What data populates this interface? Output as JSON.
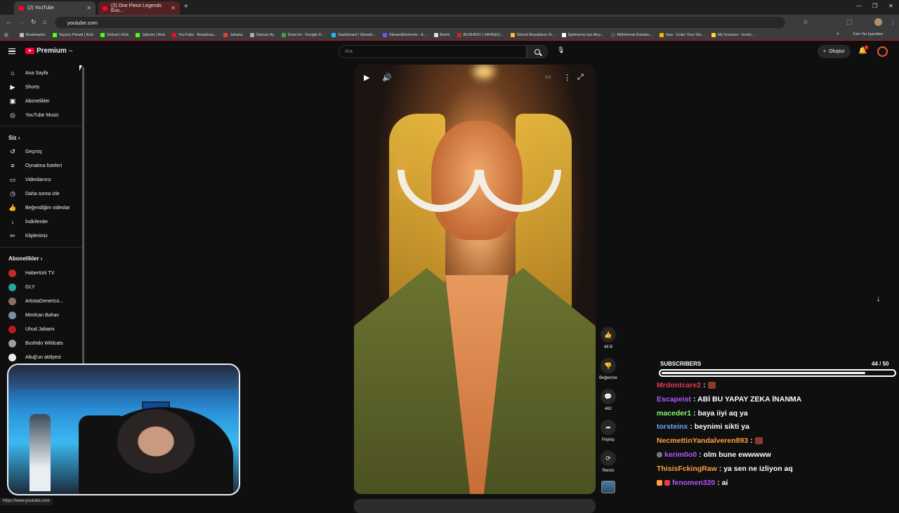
{
  "browser": {
    "tabs": [
      {
        "label": "(2) YouTube"
      },
      {
        "label": "(2) One Piece Legends Evo..."
      }
    ],
    "url": "youtube.com",
    "all_bookmarks_label": "Tüm Yer İşaretleri",
    "status_url": "https://www.youtube.com",
    "bookmarks": [
      {
        "label": "Bookmarks",
        "color": "#bbbbbb"
      },
      {
        "label": "Yayıncı Paneli | Kick",
        "color": "#53fc18"
      },
      {
        "label": "Götzat | Kick",
        "color": "#53fc18"
      },
      {
        "label": "Jahrein | Kick",
        "color": "#53fc18"
      },
      {
        "label": "YouTube - Broadcas...",
        "color": "#ff0033"
      },
      {
        "label": "Jaharia",
        "color": "#e04040"
      },
      {
        "label": "Oturum Aç",
        "color": "#aaaaaa"
      },
      {
        "label": "Drive'ım - Google D...",
        "color": "#34a853"
      },
      {
        "label": "Dashboard / Stream...",
        "color": "#29b6f6"
      },
      {
        "label": "StreamElements - A...",
        "color": "#7c4dff"
      },
      {
        "label": "Botrix",
        "color": "#dddddd"
      },
      {
        "label": "BUSHIDO | SAVAŞÇI...",
        "color": "#c62828"
      },
      {
        "label": "Görsel Boyutlarını N...",
        "color": "#fbc02d"
      },
      {
        "label": "İşletmeniz için Akıy...",
        "color": "#ffffff"
      },
      {
        "label": "Mühimmat Kutuları...",
        "color": "#555555"
      },
      {
        "label": "ikas - Enter Your Sto...",
        "color": "#ffb300"
      },
      {
        "label": "My Invoices - Invoic...",
        "color": "#fdd835"
      }
    ]
  },
  "header": {
    "logo_text": "Premium",
    "logo_badge": "TR",
    "search_placeholder": "Ara",
    "create_label": "Oluştur",
    "notifications_count": "2"
  },
  "sidebar": {
    "main": [
      {
        "label": "Ana Sayfa",
        "icon": "home-icon",
        "glyph": "⌂"
      },
      {
        "label": "Shorts",
        "icon": "shorts-icon",
        "glyph": "▶"
      },
      {
        "label": "Abonelikler",
        "icon": "subscriptions-icon",
        "glyph": "▣"
      },
      {
        "label": "YouTube Music",
        "icon": "music-icon",
        "glyph": "◎"
      }
    ],
    "you_heading": "Siz",
    "you_items": [
      {
        "label": "Geçmiş",
        "icon": "history-icon",
        "glyph": "↺"
      },
      {
        "label": "Oynatma listeleri",
        "icon": "playlist-icon",
        "glyph": "≡"
      },
      {
        "label": "Videolarınız",
        "icon": "your-videos-icon",
        "glyph": "▭"
      },
      {
        "label": "Daha sonra izle",
        "icon": "watch-later-icon",
        "glyph": "◷"
      },
      {
        "label": "Beğendiğim videolar",
        "icon": "liked-icon",
        "glyph": "👍"
      },
      {
        "label": "İndirilenler",
        "icon": "download-icon",
        "glyph": "↓"
      },
      {
        "label": "Kliplerimiz",
        "icon": "clips-icon",
        "glyph": "✂"
      }
    ],
    "subs_heading": "Abonelikler",
    "channels": [
      {
        "label": "Habertürk TV",
        "color": "#c62828"
      },
      {
        "label": "GLY",
        "color": "#26a69a"
      },
      {
        "label": "ArtistaGenerico...",
        "color": "#8d6e63"
      },
      {
        "label": "Mevlcan Bahav",
        "color": "#78909c"
      },
      {
        "label": "Uhud Jabami",
        "color": "#b71c1c"
      },
      {
        "label": "Bushido Wildcats",
        "color": "#9e9e9e"
      },
      {
        "label": "Altuğ'un atölyesi",
        "color": "#eeeeee"
      }
    ]
  },
  "short": {
    "actions": [
      {
        "label": "44 B",
        "icon": "like-icon",
        "glyph": "👍"
      },
      {
        "label": "Beğenme",
        "icon": "dislike-icon",
        "glyph": "👎"
      },
      {
        "label": "462",
        "icon": "comment-icon",
        "glyph": "💬"
      },
      {
        "label": "Paylaş",
        "icon": "share-icon",
        "glyph": "➦"
      },
      {
        "label": "Remix",
        "icon": "remix-icon",
        "glyph": "⟳"
      }
    ]
  },
  "overlay": {
    "subs_label": "SUBSCRIBERS",
    "subs_count": "44 / 50",
    "subs_progress": 0.88,
    "chat": [
      {
        "user": "Mrdontcare2",
        "color": "#e53950",
        "message": ":",
        "emote": true
      },
      {
        "user": "Escapeist",
        "color": "#b257ff",
        "message": ": ABİ BU YAPAY ZEKA İNANMA",
        "emote": false
      },
      {
        "user": "maceder1",
        "color": "#7fff6b",
        "message": ": baya iiyi aq ya",
        "emote": false
      },
      {
        "user": "torsteinx",
        "color": "#6aa5ff",
        "message": ": beynimi sikti ya",
        "emote": false
      },
      {
        "user": "NecmettinYandalveren893",
        "color": "#ff9f40",
        "message": ":",
        "emote": true
      },
      {
        "user": "kerim0o0",
        "color": "#b257ff",
        "message": ": olm bune ewwwww",
        "emote": false
      },
      {
        "user": "ThisisFckingRaw",
        "color": "#ff9f40",
        "message": ": ya sen ne izliyon aq",
        "emote": false
      },
      {
        "user": "fenomen320",
        "color": "#b257ff",
        "message": ": ai",
        "emote": false
      }
    ]
  }
}
